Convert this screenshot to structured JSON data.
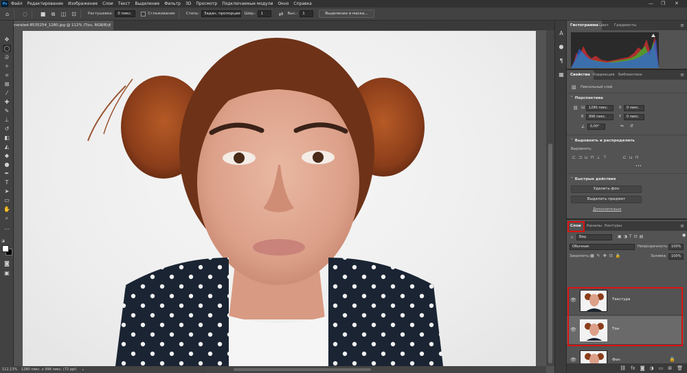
{
  "menubar": {
    "logo": "Ps",
    "items": [
      "Файл",
      "Редактирование",
      "Изображение",
      "Слои",
      "Текст",
      "Выделение",
      "Фильтр",
      "3D",
      "Просмотр",
      "Подключаемые модули",
      "Окно",
      "Справка"
    ],
    "window_controls": [
      "—",
      "❐",
      "✕"
    ]
  },
  "options": {
    "feather_label": "Растушевка:",
    "feather_value": "0 пикс.",
    "antialias_label": "Сглаживание",
    "style_label": "Стиль:",
    "style_value": "Задан. пропорции",
    "width_label": "Шир.:",
    "width_value": "1",
    "height_label": "Выс.:",
    "height_value": "1",
    "select_mask_button": "Выделение и маска..."
  },
  "document": {
    "tab_title": "nerated-8535254_1280.jpg @ 112% (Тон, RGB/8) *",
    "close": "×"
  },
  "status": {
    "zoom": "112,13%",
    "info": "1280 пикс. x 996 пикс. (72 ppi)",
    "arrow": "›"
  },
  "panels": {
    "top_tabs": [
      "Гистограмма",
      "Цвет",
      "Градиенты"
    ],
    "mid_tabs": [
      "Свойства",
      "Коррекция",
      "Библиотеки"
    ],
    "properties": {
      "layer_type": "Пиксельный слой",
      "transform_title": "Перспектива",
      "w_label": "Ш",
      "w_value": "1280 пикс.",
      "x_label": "X",
      "x_value": "0 пикс.",
      "h_label": "В",
      "h_value": "996 пикс.",
      "y_label": "Y",
      "y_value": "0 пикс.",
      "angle_value": "0,00°",
      "align_title": "Выровнять и распределить",
      "align_label": "Выровнять:",
      "more": "•••",
      "quick_title": "Быстрые действия",
      "remove_bg": "Удалить фон",
      "select_subject": "Выделить предмет",
      "more_link": "Дополнительно"
    },
    "layers_tabs": [
      "Слои",
      "Каналы",
      "Контуры"
    ],
    "layers": {
      "filter_value": "Вид",
      "blend_mode": "Обычные",
      "opacity_label": "Непрозрачность:",
      "opacity_value": "100%",
      "lock_label": "Закрепить:",
      "fill_label": "Заливка:",
      "fill_value": "100%",
      "items": [
        {
          "name": "Текстура",
          "visible": true,
          "selected": false,
          "locked": false
        },
        {
          "name": "Тон",
          "visible": true,
          "selected": true,
          "locked": false
        },
        {
          "name": "Фон",
          "visible": true,
          "selected": false,
          "locked": true
        }
      ],
      "bottom_icons": [
        "link-icon",
        "fx-icon",
        "mask-icon",
        "adjustment-icon",
        "folder-icon",
        "new-layer-icon",
        "trash-icon"
      ]
    }
  },
  "colors": {
    "highlight_red": "#e01010",
    "dress": "#1a2433",
    "hair": "#8a3d1a"
  }
}
